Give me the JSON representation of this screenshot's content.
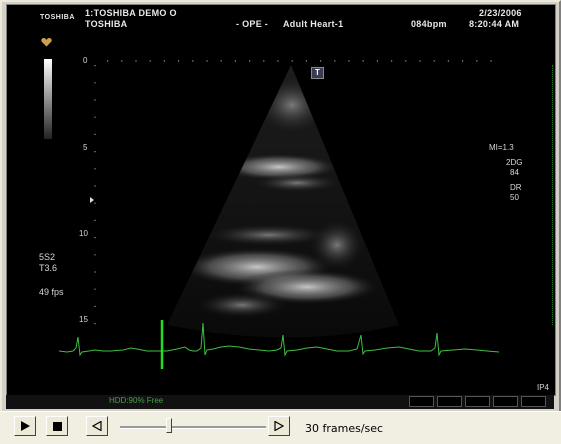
{
  "header": {
    "brand_line1": "TOSHIBA",
    "title_line1": "1:TOSHIBA DEMO      O",
    "title_line2": "TOSHIBA",
    "mode": "- OPE -",
    "preset": "Adult Heart-1",
    "heart_rate": "084bpm",
    "date": "2/23/2006",
    "time": "8:20:44 AM"
  },
  "depth_scale": {
    "labels": [
      "0",
      "5",
      "10",
      "15"
    ]
  },
  "left_info": {
    "probe": "5S2",
    "tis": "T3.6",
    "frame_rate": "49 fps"
  },
  "right_info": {
    "mi": "MI=1.3",
    "mode_2d": "2DG",
    "gain_2d": "84",
    "dr_label": "DR",
    "dr_value": "50"
  },
  "bottom_right": "IP4",
  "status": {
    "hdd": "HDD:90% Free"
  },
  "controls": {
    "speed_text": "30 frames/sec",
    "speed_level": 0.32
  },
  "marker_label": "T",
  "colors": {
    "ecg": "#3fbf3f",
    "cursor": "#22dd22",
    "background": "#000000",
    "heart_icon": "#c8a050"
  },
  "icons": [
    "heart-icon",
    "play-icon",
    "stop-icon",
    "step-back-icon",
    "step-forward-icon"
  ]
}
